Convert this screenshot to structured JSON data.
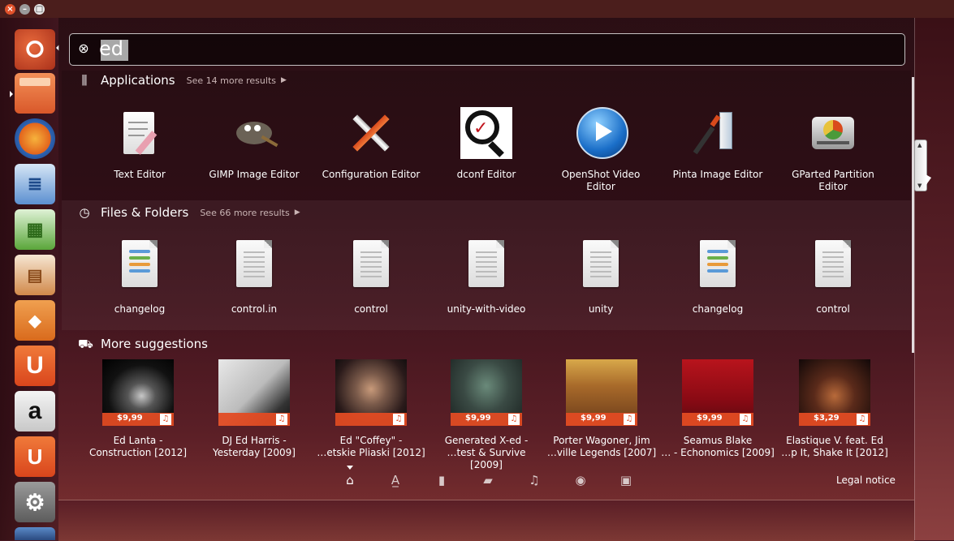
{
  "search": {
    "value": "ed",
    "clear_icon": "clear-search-icon"
  },
  "sections": {
    "applications": {
      "title": "Applications",
      "more": "See 14 more results",
      "icon": "applications-icon"
    },
    "files": {
      "title": "Files & Folders",
      "more": "See 66 more results",
      "icon": "clock-icon"
    },
    "suggestions": {
      "title": "More suggestions",
      "icon": "shopping-bag-icon"
    }
  },
  "applications": [
    {
      "line1": "Text Editor",
      "line2": ""
    },
    {
      "line1": "GIMP Image Editor",
      "line2": ""
    },
    {
      "line1": "Configuration Editor",
      "line2": ""
    },
    {
      "line1": "dconf Editor",
      "line2": ""
    },
    {
      "line1": "OpenShot Video",
      "line2": "Editor"
    },
    {
      "line1": "Pinta Image Editor",
      "line2": ""
    },
    {
      "line1": "GParted Partition",
      "line2": "Editor"
    }
  ],
  "files": [
    {
      "name": "changelog"
    },
    {
      "name": "control.in"
    },
    {
      "name": "control"
    },
    {
      "name": "unity-with-video"
    },
    {
      "name": "unity"
    },
    {
      "name": "changelog"
    },
    {
      "name": "control"
    }
  ],
  "suggestions": [
    {
      "line1": "Ed Lanta -",
      "line2": "Construction [2012]",
      "price": "$9,99"
    },
    {
      "line1": "DJ Ed Harris -",
      "line2": "Yesterday [2009]",
      "price": ""
    },
    {
      "line1": "Ed \"Coffey\" -",
      "line2": "…etskie Pliaski [2012]",
      "price": ""
    },
    {
      "line1": "Generated X-ed -",
      "line2": "…test & Survive [2009]",
      "price": "$9,99"
    },
    {
      "line1": "Porter Wagoner, Jim",
      "line2": "…ville Legends [2007]",
      "price": "$9,99"
    },
    {
      "line1": "Seamus Blake",
      "line2": "… - Echonomics [2009]",
      "price": "$9,99"
    },
    {
      "line1": "Elastique V. feat. Ed",
      "line2": "…p It, Shake It [2012]",
      "price": "$3,29"
    }
  ],
  "lenses": [
    "home-lens-icon",
    "applications-lens-icon",
    "files-lens-icon",
    "social-lens-icon",
    "music-lens-icon",
    "photos-lens-icon",
    "video-lens-icon"
  ],
  "legal_notice": "Legal notice",
  "launcher": [
    "dash-home",
    "files",
    "firefox",
    "libreoffice-writer",
    "libreoffice-calc",
    "libreoffice-impress",
    "ubuntu-software-center",
    "ubuntu-one",
    "amazon",
    "ubuntu-one-music",
    "system-settings",
    "workspaces"
  ],
  "colors": {
    "accent": "#e14b23",
    "launcher_active": "#c0391c"
  }
}
